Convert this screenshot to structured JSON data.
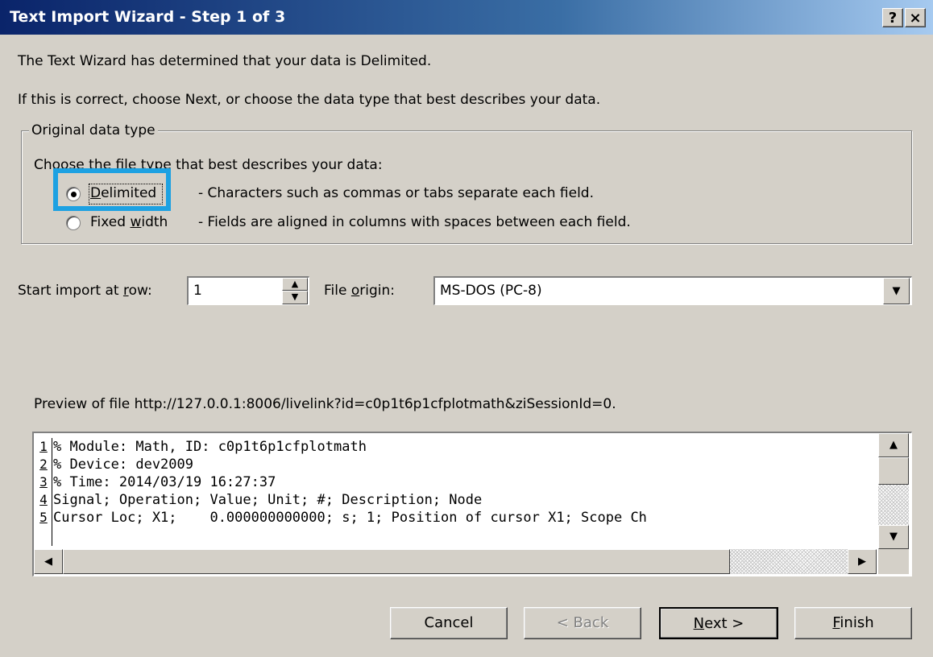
{
  "window": {
    "title": "Text Import Wizard - Step 1 of 3",
    "help_button": "?",
    "close_button": "×"
  },
  "intro": {
    "line1": "The Text Wizard has determined that your data is Delimited.",
    "line2": "If this is correct, choose Next, or choose the data type that best describes your data."
  },
  "original_data_type": {
    "legend": "Original data type",
    "prompt": "Choose the file type that best describes your data:",
    "options": [
      {
        "label_pre": "",
        "label_acc": "D",
        "label_post": "elimited",
        "description": "- Characters such as commas or tabs separate each field.",
        "checked": true
      },
      {
        "label_pre": "Fixed ",
        "label_acc": "w",
        "label_post": "idth",
        "description": "- Fields are aligned in columns with spaces between each field.",
        "checked": false
      }
    ]
  },
  "start_row": {
    "label_pre": "Start import at ",
    "label_acc": "r",
    "label_post": "ow:",
    "value": "1"
  },
  "file_origin": {
    "label_pre": "File ",
    "label_acc": "o",
    "label_post": "rigin:",
    "value": "MS-DOS (PC-8)"
  },
  "preview": {
    "label": "Preview of file http://127.0.0.1:8006/livelink?id=c0p1t6p1cfplotmath&ziSessionId=0.",
    "lines": [
      {
        "num": "1",
        "text": "% Module: Math, ID: c0p1t6p1cfplotmath"
      },
      {
        "num": "2",
        "text": "% Device: dev2009"
      },
      {
        "num": "3",
        "text": "% Time: 2014/03/19 16:27:37"
      },
      {
        "num": "4",
        "text": "Signal; Operation; Value; Unit; #; Description; Node"
      },
      {
        "num": "5",
        "text": "Cursor Loc; X1;    0.000000000000; s; 1; Position of cursor X1; Scope Ch"
      }
    ]
  },
  "buttons": {
    "cancel": "Cancel",
    "back": "< Back",
    "next_acc": "N",
    "next_post": "ext >",
    "finish_acc": "F",
    "finish_post": "inish"
  }
}
